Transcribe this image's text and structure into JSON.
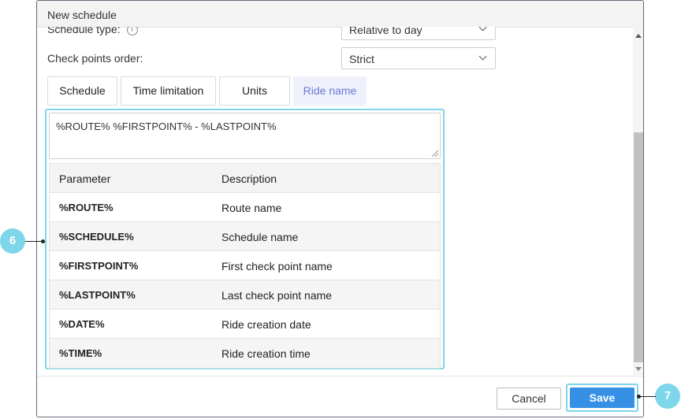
{
  "dialog": {
    "title": "New schedule"
  },
  "fields": {
    "schedule_type": {
      "label": "Schedule type:",
      "value": "Relative to day"
    },
    "check_points_order": {
      "label": "Check points order:",
      "value": "Strict"
    }
  },
  "tabs": [
    {
      "label": "Schedule"
    },
    {
      "label": "Time limitation"
    },
    {
      "label": "Units"
    },
    {
      "label": "Ride name"
    }
  ],
  "ride_name": {
    "template": "%ROUTE% %FIRSTPOINT% - %LASTPOINT%",
    "table": {
      "headers": [
        "Parameter",
        "Description"
      ],
      "rows": [
        {
          "param": "%ROUTE%",
          "desc": "Route name"
        },
        {
          "param": "%SCHEDULE%",
          "desc": "Schedule name"
        },
        {
          "param": "%FIRSTPOINT%",
          "desc": "First check point name"
        },
        {
          "param": "%LASTPOINT%",
          "desc": "Last check point name"
        },
        {
          "param": "%DATE%",
          "desc": "Ride creation date"
        },
        {
          "param": "%TIME%",
          "desc": "Ride creation time"
        }
      ]
    }
  },
  "footer": {
    "cancel_label": "Cancel",
    "save_label": "Save"
  },
  "callouts": {
    "panel": "6",
    "save": "7"
  },
  "colors": {
    "accent": "#7dd6ea",
    "primary": "#3590e6",
    "active_tab_text": "#6b7bd6"
  }
}
